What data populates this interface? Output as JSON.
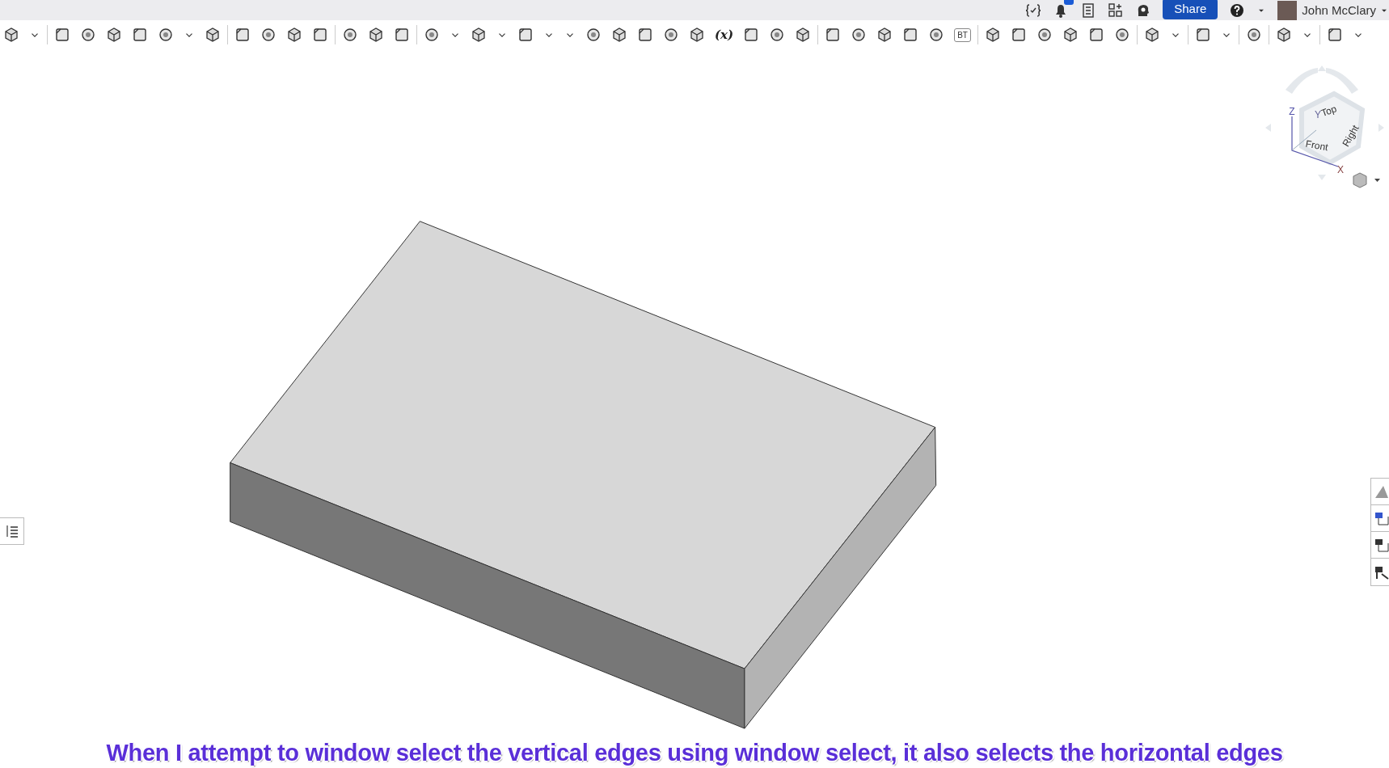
{
  "top_bar": {
    "share_button": "Share",
    "user_name": "John McClary"
  },
  "toolbar": {
    "variable_button": "(x)",
    "bt_button": "BT"
  },
  "view_cube": {
    "faces": [
      "Top",
      "Front",
      "Right"
    ],
    "axes": [
      "Z",
      "X",
      "Y"
    ]
  },
  "caption": "When I attempt to window select the vertical edges using window select, it also selects the horizontal edges"
}
